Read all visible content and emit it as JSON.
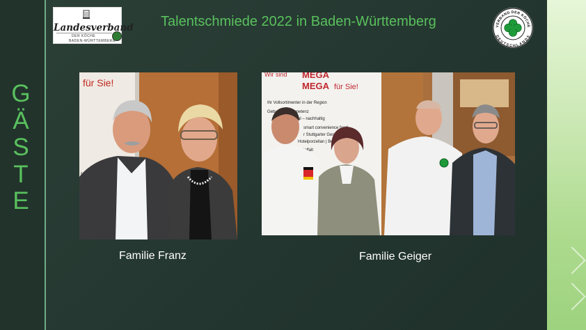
{
  "slide": {
    "title": "Talentschmiede 2022 in Baden-Württemberg",
    "side_title_letters": [
      "G",
      "Ä",
      "S",
      "T",
      "E"
    ],
    "colors": {
      "accent_green": "#59c15d",
      "background": "#263a32",
      "caption_text": "#ffffff"
    }
  },
  "logo_left": {
    "name": "Landesverband",
    "subtitle_line1": "DER KÖCHE",
    "subtitle_line2": "BADEN-WÜRTTEMBERG"
  },
  "logo_right": {
    "ring_text_top": "VERBAND DER KÖCHE",
    "ring_text_bottom": "DEUTSCHLANDS"
  },
  "photos": [
    {
      "caption": "Familie Franz",
      "banner_text": "für Sie!",
      "side_text": "ufaktur"
    },
    {
      "caption": "Familie Geiger",
      "banner_headline_1": "MEGA",
      "banner_headline_2": "MEGA",
      "banner_headline_suffix": "für Sie!",
      "banner_prefix": "Wir sind",
      "banner_bullets": [
        "Ihr Vollsortimenter in der Region",
        "Gebu  eischkompetenz",
        "  al – nachhaltig",
        "smart convenience food",
        "r Stuttgarter Genussmanu",
        "Hotelporzellan | Beruf",
        "ielfalt"
      ]
    }
  ]
}
